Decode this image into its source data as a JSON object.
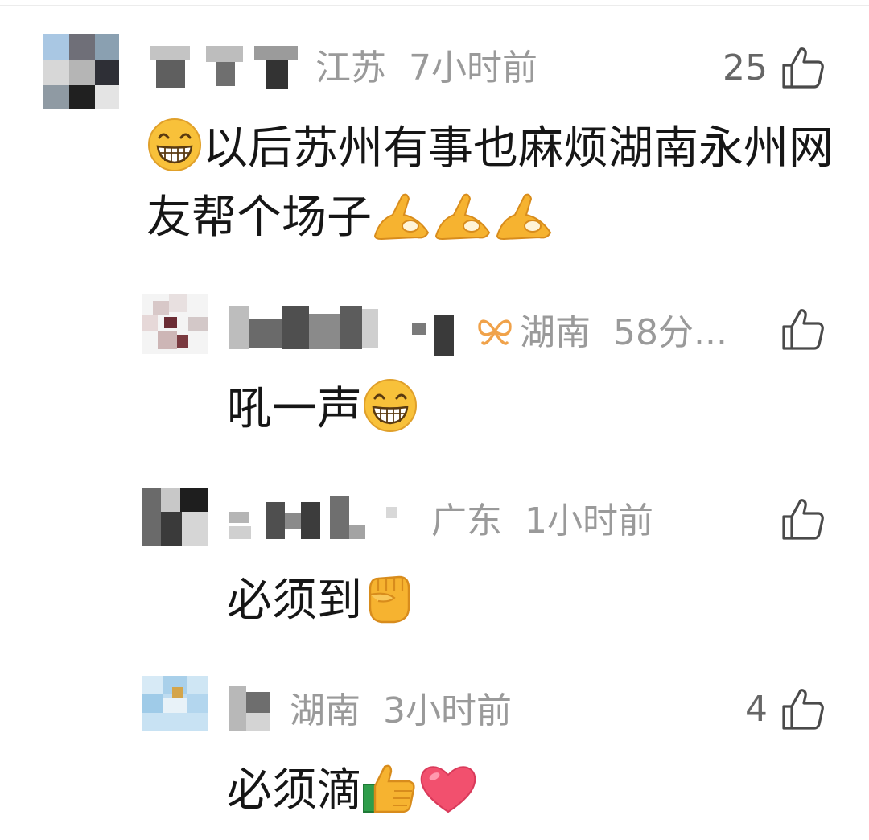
{
  "comments": [
    {
      "region": "江苏",
      "time": "7小时前",
      "likes": "25",
      "text": "以后苏州有事也麻烦湖南永州网友帮个场子"
    },
    {
      "region": "湖南",
      "time": "58分...",
      "likes": "",
      "text": "吼一声"
    },
    {
      "region": "广东",
      "time": "1小时前",
      "likes": "",
      "text": "必须到"
    },
    {
      "region": "湖南",
      "time": "3小时前",
      "likes": "4",
      "text": "必须滴"
    }
  ],
  "icons": {
    "like": "thumb-up-outline-icon",
    "grin": "grinning-face-emoji",
    "ok_hand": "ok-hand-emoji",
    "fist": "raised-fist-emoji",
    "thumbs_up": "thumbs-up-emoji",
    "heart": "heart-emoji",
    "vip": "vip-badge-icon"
  },
  "colors": {
    "text": "#161616",
    "meta": "#9a9a9a",
    "like_count": "#666666",
    "vip_badge": "#f0a24a"
  }
}
